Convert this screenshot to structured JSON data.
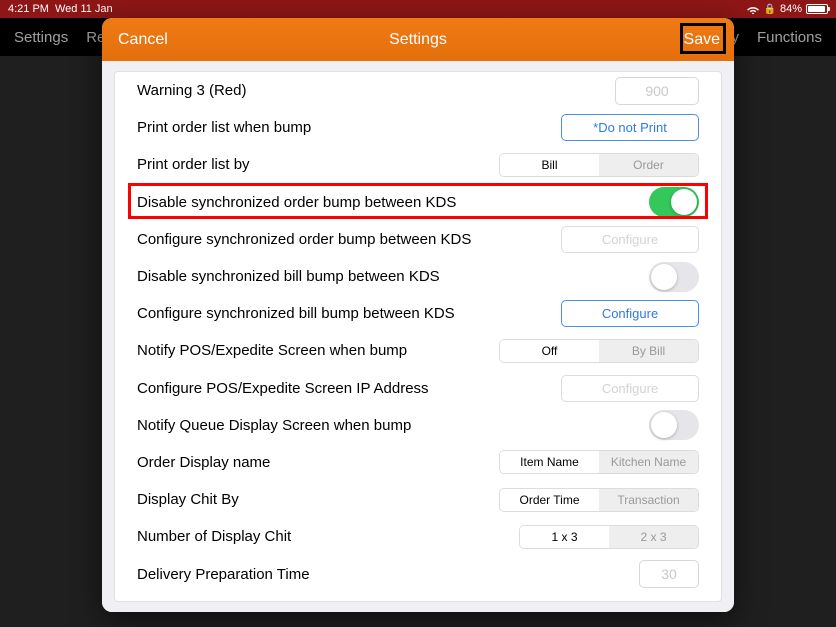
{
  "statusbar": {
    "time": "4:21 PM",
    "date": "Wed 11 Jan",
    "battery": "84%"
  },
  "backnav": {
    "left1": "Settings",
    "left2": "Re",
    "rightTrunc": "y",
    "right2": "Functions"
  },
  "modal": {
    "cancel": "Cancel",
    "title": "Settings",
    "save": "Save"
  },
  "rows": {
    "warning3": {
      "label": "Warning 3 (Red)",
      "value": "900"
    },
    "printBump": {
      "label": "Print order list when bump",
      "button": "*Do not Print"
    },
    "printBy": {
      "label": "Print order list by",
      "optA": "Bill",
      "optB": "Order"
    },
    "disSyncOrder": {
      "label": "Disable synchronized order bump between KDS"
    },
    "cfgSyncOrder": {
      "label": "Configure synchronized order bump between KDS",
      "button": "Configure"
    },
    "disSyncBill": {
      "label": "Disable synchronized bill bump between KDS"
    },
    "cfgSyncBill": {
      "label": "Configure synchronized bill bump between KDS",
      "button": "Configure"
    },
    "notifyPOS": {
      "label": "Notify POS/Expedite Screen when bump",
      "optA": "Off",
      "optB": "By Bill"
    },
    "cfgIP": {
      "label": "Configure POS/Expedite Screen IP Address",
      "button": "Configure"
    },
    "notifyQueue": {
      "label": "Notify Queue Display Screen when bump"
    },
    "dispName": {
      "label": "Order Display name",
      "optA": "Item Name",
      "optB": "Kitchen Name"
    },
    "chitBy": {
      "label": "Display Chit By",
      "optA": "Order Time",
      "optB": "Transaction"
    },
    "numChit": {
      "label": "Number of Display Chit",
      "optA": "1 x 3",
      "optB": "2 x 3"
    },
    "delivPrep": {
      "label": "Delivery Preparation Time",
      "value": "30"
    }
  }
}
